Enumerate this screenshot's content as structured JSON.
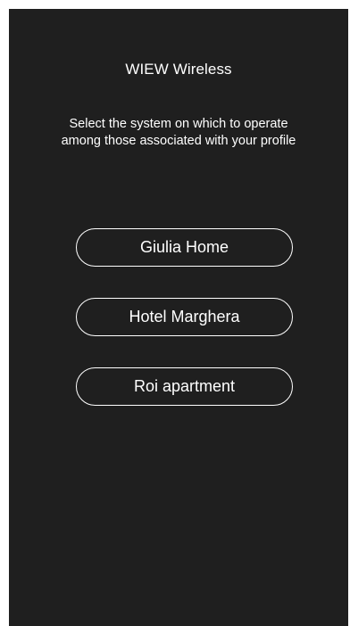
{
  "header": {
    "title": "WIEW Wireless"
  },
  "instructions": {
    "line1": "Select the system on which to operate",
    "line2": "among those associated with your profile"
  },
  "systems": [
    {
      "label": "Giulia Home"
    },
    {
      "label": "Hotel Marghera"
    },
    {
      "label": "Roi apartment"
    }
  ],
  "colors": {
    "background": "#1f1f1f",
    "text": "#ffffff",
    "button_border": "#ffffff"
  }
}
